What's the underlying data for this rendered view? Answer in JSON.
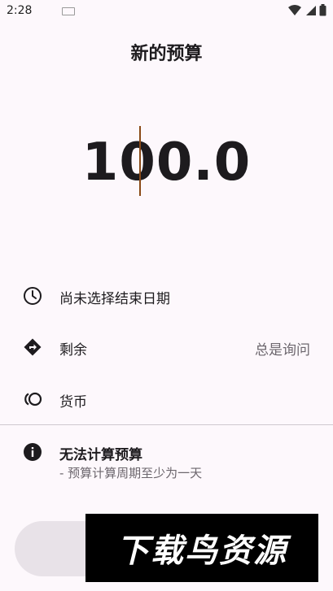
{
  "status_bar": {
    "time": "2:28",
    "icons": [
      "keyboard-icon",
      "wifi-icon",
      "signal-icon",
      "battery-icon"
    ]
  },
  "header": {
    "title": "新的预算"
  },
  "amount": {
    "value": "100.0"
  },
  "rows": {
    "end_date": {
      "label": "尚未选择结束日期",
      "icon": "clock-icon"
    },
    "remaining": {
      "label": "剩余",
      "value": "总是询问",
      "icon": "directions-icon"
    },
    "currency": {
      "label": "货币",
      "icon": "currency-icon"
    }
  },
  "info": {
    "title": "无法计算预算",
    "subtitle": "- 预算计算周期至少为一天",
    "icon": "info-icon"
  },
  "watermark": {
    "text": "下载鸟资源"
  },
  "colors": {
    "background": "#fdf8fc",
    "caret": "#8a4a17",
    "button": "#e8e2e8"
  }
}
